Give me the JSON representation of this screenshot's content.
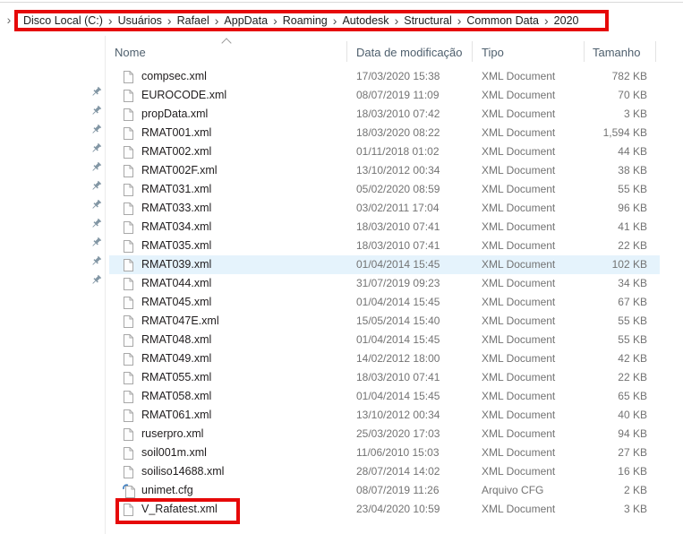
{
  "breadcrumb": {
    "leading_chevron": "›",
    "separator": "›",
    "items": [
      "Disco Local (C:)",
      "Usuários",
      "Rafael",
      "AppData",
      "Roaming",
      "Autodesk",
      "Structural",
      "Common Data",
      "2020"
    ]
  },
  "columns": {
    "name": "Nome",
    "date": "Data de modificação",
    "type": "Tipo",
    "size": "Tamanho"
  },
  "sort": {
    "column": "Nome",
    "direction": "ascending"
  },
  "files": [
    {
      "name": "compsec.xml",
      "date": "17/03/2020 15:38",
      "type": "XML Document",
      "size": "782 KB",
      "pinned": false,
      "selected": false,
      "icon": "xml",
      "annotated": false
    },
    {
      "name": "EUROCODE.xml",
      "date": "08/07/2019 11:09",
      "type": "XML Document",
      "size": "70 KB",
      "pinned": true,
      "selected": false,
      "icon": "xml",
      "annotated": false
    },
    {
      "name": "propData.xml",
      "date": "18/03/2010 07:42",
      "type": "XML Document",
      "size": "3 KB",
      "pinned": true,
      "selected": false,
      "icon": "xml",
      "annotated": false
    },
    {
      "name": "RMAT001.xml",
      "date": "18/03/2020 08:22",
      "type": "XML Document",
      "size": "1,594 KB",
      "pinned": true,
      "selected": false,
      "icon": "xml",
      "annotated": false
    },
    {
      "name": "RMAT002.xml",
      "date": "01/11/2018 01:02",
      "type": "XML Document",
      "size": "44 KB",
      "pinned": true,
      "selected": false,
      "icon": "xml",
      "annotated": false
    },
    {
      "name": "RMAT002F.xml",
      "date": "13/10/2012 00:34",
      "type": "XML Document",
      "size": "38 KB",
      "pinned": true,
      "selected": false,
      "icon": "xml",
      "annotated": false
    },
    {
      "name": "RMAT031.xml",
      "date": "05/02/2020 08:59",
      "type": "XML Document",
      "size": "55 KB",
      "pinned": true,
      "selected": false,
      "icon": "xml",
      "annotated": false
    },
    {
      "name": "RMAT033.xml",
      "date": "03/02/2011 17:04",
      "type": "XML Document",
      "size": "96 KB",
      "pinned": true,
      "selected": false,
      "icon": "xml",
      "annotated": false
    },
    {
      "name": "RMAT034.xml",
      "date": "18/03/2010 07:41",
      "type": "XML Document",
      "size": "41 KB",
      "pinned": true,
      "selected": false,
      "icon": "xml",
      "annotated": false
    },
    {
      "name": "RMAT035.xml",
      "date": "18/03/2010 07:41",
      "type": "XML Document",
      "size": "22 KB",
      "pinned": true,
      "selected": false,
      "icon": "xml",
      "annotated": false
    },
    {
      "name": "RMAT039.xml",
      "date": "01/04/2014 15:45",
      "type": "XML Document",
      "size": "102 KB",
      "pinned": true,
      "selected": true,
      "icon": "xml",
      "annotated": false
    },
    {
      "name": "RMAT044.xml",
      "date": "31/07/2019 09:23",
      "type": "XML Document",
      "size": "34 KB",
      "pinned": true,
      "selected": false,
      "icon": "xml",
      "annotated": false
    },
    {
      "name": "RMAT045.xml",
      "date": "01/04/2014 15:45",
      "type": "XML Document",
      "size": "67 KB",
      "pinned": false,
      "selected": false,
      "icon": "xml",
      "annotated": false
    },
    {
      "name": "RMAT047E.xml",
      "date": "15/05/2014 15:40",
      "type": "XML Document",
      "size": "55 KB",
      "pinned": false,
      "selected": false,
      "icon": "xml",
      "annotated": false
    },
    {
      "name": "RMAT048.xml",
      "date": "01/04/2014 15:45",
      "type": "XML Document",
      "size": "55 KB",
      "pinned": false,
      "selected": false,
      "icon": "xml",
      "annotated": false
    },
    {
      "name": "RMAT049.xml",
      "date": "14/02/2012 18:00",
      "type": "XML Document",
      "size": "42 KB",
      "pinned": false,
      "selected": false,
      "icon": "xml",
      "annotated": false
    },
    {
      "name": "RMAT055.xml",
      "date": "18/03/2010 07:41",
      "type": "XML Document",
      "size": "22 KB",
      "pinned": false,
      "selected": false,
      "icon": "xml",
      "annotated": false
    },
    {
      "name": "RMAT058.xml",
      "date": "01/04/2014 15:45",
      "type": "XML Document",
      "size": "65 KB",
      "pinned": false,
      "selected": false,
      "icon": "xml",
      "annotated": false
    },
    {
      "name": "RMAT061.xml",
      "date": "13/10/2012 00:34",
      "type": "XML Document",
      "size": "40 KB",
      "pinned": false,
      "selected": false,
      "icon": "xml",
      "annotated": false
    },
    {
      "name": "ruserpro.xml",
      "date": "25/03/2020 17:03",
      "type": "XML Document",
      "size": "94 KB",
      "pinned": false,
      "selected": false,
      "icon": "xml",
      "annotated": false
    },
    {
      "name": "soil001m.xml",
      "date": "11/06/2010 15:03",
      "type": "XML Document",
      "size": "27 KB",
      "pinned": false,
      "selected": false,
      "icon": "xml",
      "annotated": false
    },
    {
      "name": "soiliso14688.xml",
      "date": "28/07/2014 14:02",
      "type": "XML Document",
      "size": "16 KB",
      "pinned": false,
      "selected": false,
      "icon": "xml",
      "annotated": false
    },
    {
      "name": "unimet.cfg",
      "date": "08/07/2019 11:26",
      "type": "Arquivo CFG",
      "size": "2 KB",
      "pinned": false,
      "selected": false,
      "icon": "cfg",
      "annotated": false
    },
    {
      "name": "V_Rafatest.xml",
      "date": "23/04/2020 10:59",
      "type": "XML Document",
      "size": "3 KB",
      "pinned": false,
      "selected": false,
      "icon": "xml",
      "annotated": true
    }
  ],
  "colors": {
    "annotation_red": "#e60909",
    "selection_background": "#e5f3fc",
    "header_text": "#4e5f6d",
    "primary_text": "#201d1e",
    "secondary_text": "#737373",
    "pin_gray": "#8296a4"
  }
}
